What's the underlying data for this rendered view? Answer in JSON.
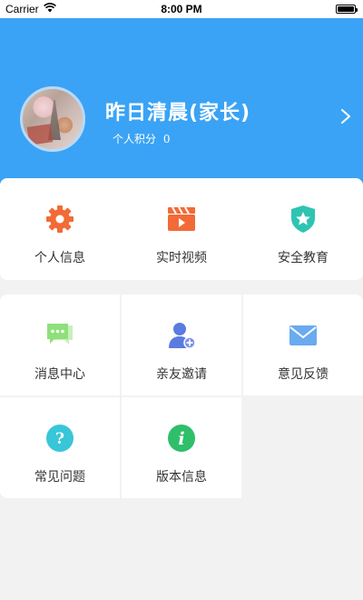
{
  "status_bar": {
    "carrier": "Carrier",
    "time": "8:00 PM"
  },
  "profile": {
    "name": "昨日清晨(家长)",
    "points_label": "个人积分",
    "points_value": "0"
  },
  "menu_primary": [
    {
      "label": "个人信息",
      "icon": "gear-icon",
      "color": "#f26b37"
    },
    {
      "label": "实时视频",
      "icon": "clapperboard-icon",
      "color": "#f26b37"
    },
    {
      "label": "安全教育",
      "icon": "shield-star-icon",
      "color": "#2fc4b2"
    }
  ],
  "menu_secondary": [
    {
      "label": "消息中心",
      "icon": "chat-icon",
      "color": "#8ee07a"
    },
    {
      "label": "亲友邀请",
      "icon": "add-person-icon",
      "color": "#5b7be0"
    },
    {
      "label": "意见反馈",
      "icon": "envelope-icon",
      "color": "#6aaaf0"
    },
    {
      "label": "常见问题",
      "icon": "question-icon",
      "color": "#38c6d8"
    },
    {
      "label": "版本信息",
      "icon": "info-icon",
      "color": "#2fbf6b"
    }
  ],
  "colors": {
    "header_bg": "#3aa3f5",
    "page_bg": "#f2f2f2"
  }
}
